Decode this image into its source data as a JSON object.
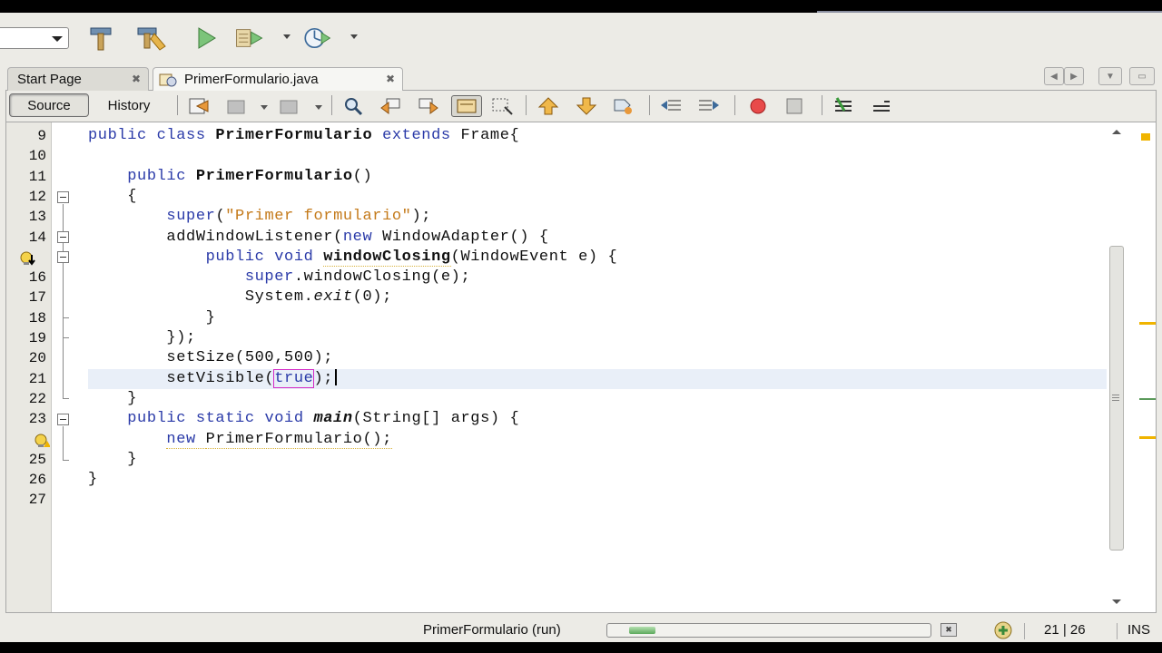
{
  "tabs": [
    {
      "label": "Start Page",
      "active": false
    },
    {
      "label": "PrimerFormulario.java",
      "active": true
    }
  ],
  "editor_toolbar": {
    "source_label": "Source",
    "history_label": "History"
  },
  "code_lines": [
    {
      "num": "9",
      "tokens": [
        [
          "kw",
          "public class "
        ],
        [
          "b",
          "PrimerFormulario "
        ],
        [
          "kw",
          "extends "
        ],
        [
          "",
          "Frame{"
        ]
      ]
    },
    {
      "num": "10",
      "tokens": []
    },
    {
      "num": "11",
      "tokens": [
        [
          "",
          "    "
        ],
        [
          "kw",
          "public "
        ],
        [
          "b",
          "PrimerFormulario"
        ],
        [
          "",
          "()"
        ]
      ]
    },
    {
      "num": "12",
      "tokens": [
        [
          "",
          "    {"
        ]
      ]
    },
    {
      "num": "13",
      "tokens": [
        [
          "",
          "        "
        ],
        [
          "kw",
          "super"
        ],
        [
          "",
          "("
        ],
        [
          "str",
          "\"Primer formulario\""
        ],
        [
          "",
          ");"
        ]
      ]
    },
    {
      "num": "14",
      "tokens": [
        [
          "",
          "        addWindowListener("
        ],
        [
          "kw",
          "new "
        ],
        [
          "",
          "WindowAdapter() {"
        ]
      ]
    },
    {
      "num": "",
      "tokens": [
        [
          "",
          "            "
        ],
        [
          "kw",
          "public void "
        ],
        [
          "bw",
          "windowClosing"
        ],
        [
          "",
          "(WindowEvent e) {"
        ]
      ]
    },
    {
      "num": "16",
      "tokens": [
        [
          "",
          "                "
        ],
        [
          "kw",
          "super"
        ],
        [
          "",
          ".windowClosing(e);"
        ]
      ]
    },
    {
      "num": "17",
      "tokens": [
        [
          "",
          "                System."
        ],
        [
          "i",
          "exit"
        ],
        [
          "",
          "(0);"
        ]
      ]
    },
    {
      "num": "18",
      "tokens": [
        [
          "",
          "            }"
        ]
      ]
    },
    {
      "num": "19",
      "tokens": [
        [
          "",
          "        });"
        ]
      ]
    },
    {
      "num": "20",
      "tokens": [
        [
          "",
          "        setSize(500,500);"
        ]
      ]
    },
    {
      "num": "21",
      "tokens": [
        [
          "",
          "        setVisible("
        ],
        [
          "kwbox",
          "true"
        ],
        [
          "",
          ");"
        ],
        [
          "caret",
          ""
        ]
      ]
    },
    {
      "num": "22",
      "tokens": [
        [
          "",
          "    }"
        ]
      ]
    },
    {
      "num": "23",
      "tokens": [
        [
          "",
          "    "
        ],
        [
          "kw",
          "public static void "
        ],
        [
          "bi",
          "main"
        ],
        [
          "",
          "(String[] args) {"
        ]
      ]
    },
    {
      "num": "",
      "tokens": [
        [
          "",
          "        "
        ],
        [
          "kwwarn",
          "new "
        ],
        [
          "warn",
          "PrimerFormulario();"
        ]
      ]
    },
    {
      "num": "25",
      "tokens": [
        [
          "",
          "    }"
        ]
      ]
    },
    {
      "num": "26",
      "tokens": [
        [
          "",
          "}"
        ]
      ]
    },
    {
      "num": "27",
      "tokens": []
    }
  ],
  "status": {
    "task_label": "PrimerFormulario (run)",
    "progress": 0.08,
    "cursor_position": "21 | 26",
    "insert_mode": "INS"
  },
  "colors": {
    "keyword": "#2a3aa8",
    "string": "#c47a1a",
    "error_mark": "#d42ac6",
    "warning": "#f0b400"
  },
  "icons": [
    "clean-build-icon",
    "build-icon",
    "run-icon",
    "debug-icon",
    "profile-icon",
    "back-icon",
    "forward-icon",
    "find-icon",
    "breakpoint-icon",
    "stop-icon"
  ]
}
